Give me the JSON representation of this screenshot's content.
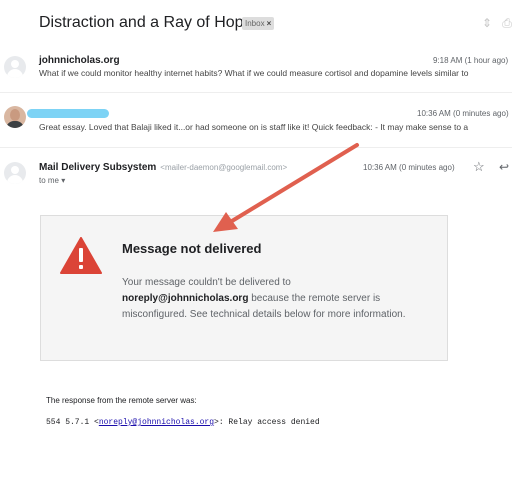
{
  "subject": "Distraction and a Ray of Hope",
  "label_badge": "Inbox",
  "label_badge_close": "×",
  "icons": {
    "subject_toggle": "chevron-up-down",
    "print": "print",
    "star": "star",
    "reply": "reply",
    "warning": "warning-triangle"
  },
  "messages": [
    {
      "sender": "johnnicholas.org",
      "time": "9:18 AM (1 hour ago)",
      "snippet": "What if we could monitor healthy internet habits? What if we could measure cortisol and dopamine levels similar to"
    },
    {
      "sender": "",
      "time": "10:36 AM (0 minutes ago)",
      "snippet": "Great essay. Loved that Balaji liked it...or had someone on is staff like it! Quick feedback: - It may make sense to a"
    },
    {
      "sender": "Mail Delivery Subsystem",
      "sender_email": "<mailer-daemon@googlemail.com>",
      "time": "10:36 AM (0 minutes ago)",
      "recipient": "to me",
      "recipient_caret": "▾"
    }
  ],
  "bounce": {
    "title": "Message not delivered",
    "body_prefix": "Your message couldn't be delivered to",
    "address": "noreply@johnnicholas.org",
    "body_suffix": "because the remote server is misconfigured. See technical details below for more information."
  },
  "response": {
    "label": "The response from the remote server was:",
    "code_prefix": "554 5.7.1 <",
    "link": "noreply@johnnicholas.org",
    "code_suffix": ">: Relay access denied"
  },
  "colors": {
    "warning": "#db4437",
    "annotation_arrow": "#e0604f",
    "redaction": "#7dd3f5",
    "link": "#1a0dab"
  }
}
